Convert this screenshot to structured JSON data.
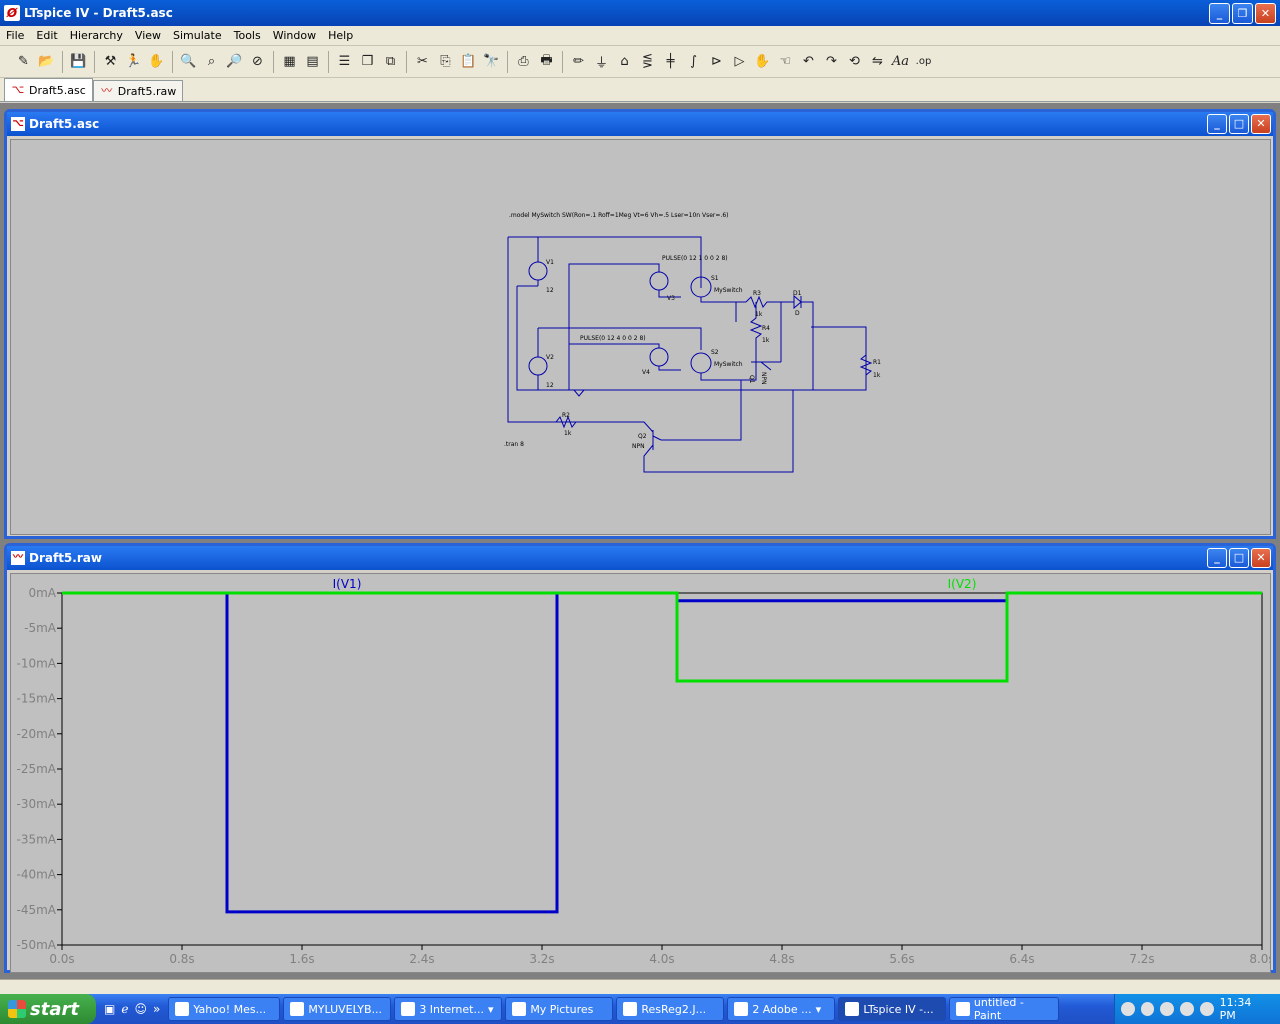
{
  "app": {
    "title": "LTspice IV - Draft5.asc",
    "icon_letter": "Ø"
  },
  "menu": [
    "File",
    "Edit",
    "Hierarchy",
    "View",
    "Simulate",
    "Tools",
    "Window",
    "Help"
  ],
  "toolbar": {
    "icons": [
      "new-schematic-icon",
      "open-icon",
      "save-icon",
      "control-panel-icon",
      "run-icon",
      "halt-icon",
      "zoom-in-icon",
      "zoom-pan-icon",
      "zoom-out-icon",
      "zoom-cancel-icon",
      "autorange-icon",
      "delete-trace-icon",
      "tile-horizontal-icon",
      "cascade-icon",
      "close-all-icon",
      "cut-icon",
      "copy-icon",
      "paste-icon",
      "find-icon",
      "print-setup-icon",
      "print-icon",
      "wire-icon",
      "ground-icon",
      "label-icon",
      "resistor-icon",
      "capacitor-icon",
      "inductor-icon",
      "diode-icon",
      "component-icon",
      "move-icon",
      "drag-icon",
      "undo-icon",
      "redo-icon",
      "rotate-icon",
      "mirror-icon",
      "text-icon",
      "spice-directive-icon"
    ],
    "text_button": "Aa",
    "op_button": ".op"
  },
  "doc_tabs": [
    {
      "label": "Draft5.asc",
      "active": true
    },
    {
      "label": "Draft5.raw",
      "active": false
    }
  ],
  "schematic_window": {
    "title": "Draft5.asc",
    "model_directive": ".model MySwitch SW(Ron=.1 Roff=1Meg Vt=6 Vh=.5 Lser=10n Vser=.6)",
    "tran_directive": ".tran 8",
    "labels": {
      "V1": "V1",
      "V1_val": "12",
      "V2": "V2",
      "V2_val": "12",
      "V3": "V3",
      "V4": "V4",
      "pulse1": "PULSE(0 12 1 0 0 2 8)",
      "pulse2": "PULSE(0 12 4 0 0 2 8)",
      "S1": "S1",
      "S2": "S2",
      "S1_model": "MySwitch",
      "S2_model": "MySwitch",
      "R3": "R3",
      "R3_val": "1k",
      "R4": "R4",
      "R4_val": "1k",
      "R1": "R1",
      "R1_val": "1k",
      "R2": "R2",
      "R2_val": "1k",
      "D1": "D1",
      "D1_val": "D",
      "Q1": "Q1",
      "Q1_val": "NPN",
      "Q2": "Q2",
      "Q2_val": "NPN"
    }
  },
  "wave_window": {
    "title": "Draft5.raw",
    "colors": {
      "v1": "#0000c8",
      "v2": "#00e000",
      "bg": "#c0c0c0"
    }
  },
  "chart_data": {
    "type": "line",
    "xlabel": "",
    "ylabel": "",
    "xlim": [
      0,
      8.0
    ],
    "ylim": [
      -50,
      0
    ],
    "x_ticks": [
      "0.0s",
      "0.8s",
      "1.6s",
      "2.4s",
      "3.2s",
      "4.0s",
      "4.8s",
      "5.6s",
      "6.4s",
      "7.2s",
      "8.0s"
    ],
    "y_ticks": [
      "0mA",
      "-5mA",
      "-10mA",
      "-15mA",
      "-20mA",
      "-25mA",
      "-30mA",
      "-35mA",
      "-40mA",
      "-45mA",
      "-50mA"
    ],
    "series": [
      {
        "name": "I(V1)",
        "color": "#0000c8",
        "x": [
          0,
          1.1,
          1.1,
          3.3,
          3.3,
          4.1,
          4.1,
          6.3,
          6.3,
          8.0
        ],
        "y": [
          0,
          0,
          -45.3,
          -45.3,
          0,
          0,
          -1.1,
          -1.1,
          0,
          0
        ]
      },
      {
        "name": "I(V2)",
        "color": "#00e000",
        "x": [
          0,
          4.1,
          4.1,
          6.3,
          6.3,
          8.0
        ],
        "y": [
          0,
          0,
          -12.5,
          -12.5,
          0,
          0
        ]
      }
    ]
  },
  "taskbar": {
    "start": "start",
    "quick_launch": [
      "»"
    ],
    "tasks": [
      {
        "label": "Yahoo! Mes...",
        "active": false
      },
      {
        "label": "MYLUVELYB...",
        "active": false
      },
      {
        "label": "3 Internet...",
        "active": false
      },
      {
        "label": "My Pictures",
        "active": false
      },
      {
        "label": "ResReg2.J...",
        "active": false
      },
      {
        "label": "2 Adobe ...",
        "active": false
      },
      {
        "label": "LTspice IV -...",
        "active": true
      },
      {
        "label": "untitled - Paint",
        "active": false
      }
    ],
    "clock": "11:34 PM"
  }
}
